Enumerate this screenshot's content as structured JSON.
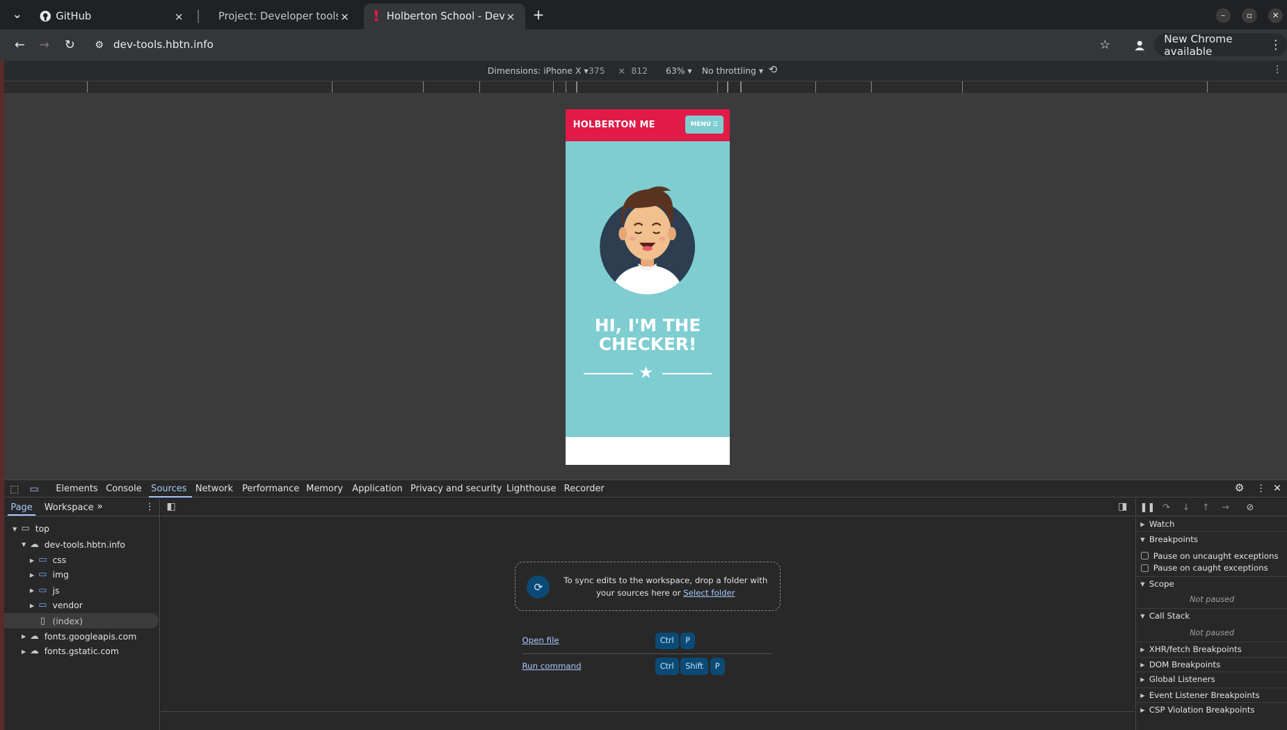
{
  "browser": {
    "tabs": [
      {
        "title": "GitHub",
        "icon": "github-icon"
      },
      {
        "title": "Project: Developer tools",
        "icon": "none"
      },
      {
        "title": "Holberton School - Devel",
        "icon": "holberton-icon"
      }
    ],
    "close_glyph": "×",
    "new_tab_glyph": "+",
    "url": "dev-tools.hbtn.info",
    "update_label": "New Chrome available"
  },
  "device_toolbar": {
    "dimensions_label": "Dimensions: iPhone X",
    "width": "375",
    "times": "×",
    "height": "812",
    "zoom": "63%",
    "throttling": "No throttling"
  },
  "page": {
    "brand": "HOLBERTON ME",
    "menu_label": "MENU",
    "hero_line1": "HI, I'M THE",
    "hero_line2": "CHECKER!",
    "colors": {
      "header": "#e11a47",
      "hero_bg": "#7ecdd1"
    }
  },
  "devtools": {
    "tabs": [
      "Elements",
      "Console",
      "Sources",
      "Network",
      "Performance",
      "Memory",
      "Application",
      "Privacy and security",
      "Lighthouse",
      "Recorder"
    ],
    "active_tab": "Sources",
    "navigator_tabs": [
      "Page",
      "Workspace"
    ],
    "tree": [
      {
        "label": "top",
        "icon": "window-icon"
      },
      {
        "label": "dev-tools.hbtn.info",
        "icon": "cloud-icon"
      },
      {
        "label": "css",
        "icon": "folder-icon"
      },
      {
        "label": "img",
        "icon": "folder-icon"
      },
      {
        "label": "js",
        "icon": "folder-icon"
      },
      {
        "label": "vendor",
        "icon": "folder-icon"
      },
      {
        "label": "(index)",
        "icon": "file-icon"
      },
      {
        "label": "fonts.googleapis.com",
        "icon": "cloud-icon"
      },
      {
        "label": "fonts.gstatic.com",
        "icon": "cloud-icon"
      }
    ],
    "dropzone_text": "To sync edits to the workspace, drop a folder with your sources here or",
    "select_folder": "Select folder",
    "shortcuts": [
      {
        "label": "Open file",
        "keys": [
          "Ctrl",
          "P"
        ]
      },
      {
        "label": "Run command",
        "keys": [
          "Ctrl",
          "Shift",
          "P"
        ]
      }
    ],
    "debugger": {
      "watch": "Watch",
      "breakpoints": "Breakpoints",
      "pause_uncaught": "Pause on uncaught exceptions",
      "pause_caught": "Pause on caught exceptions",
      "scope": "Scope",
      "not_paused": "Not paused",
      "call_stack": "Call Stack",
      "not_paused_2": "Not paused",
      "more": [
        "XHR/fetch Breakpoints",
        "DOM Breakpoints",
        "Global Listeners",
        "Event Listener Breakpoints",
        "CSP Violation Breakpoints"
      ]
    }
  }
}
